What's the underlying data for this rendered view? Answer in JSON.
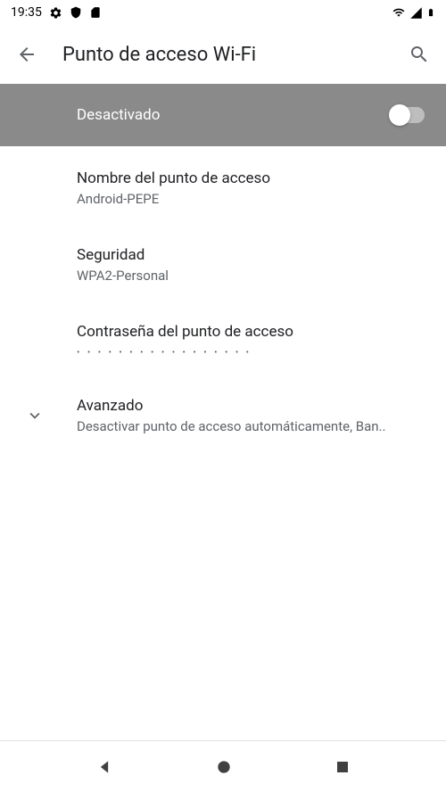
{
  "statusbar": {
    "time": "19:35"
  },
  "appbar": {
    "title": "Punto de acceso Wi-Fi"
  },
  "toggle": {
    "label": "Desactivado"
  },
  "settings": {
    "hotspot_name": {
      "title": "Nombre del punto de acceso",
      "value": "Android-PEPE"
    },
    "security": {
      "title": "Seguridad",
      "value": "WPA2-Personal"
    },
    "password": {
      "title": "Contraseña del punto de acceso",
      "mask": "• • • • • • • • • • • • • • • • •"
    },
    "advanced": {
      "title": "Avanzado",
      "subtitle": "Desactivar punto de acceso automáticamente, Ban.."
    }
  }
}
